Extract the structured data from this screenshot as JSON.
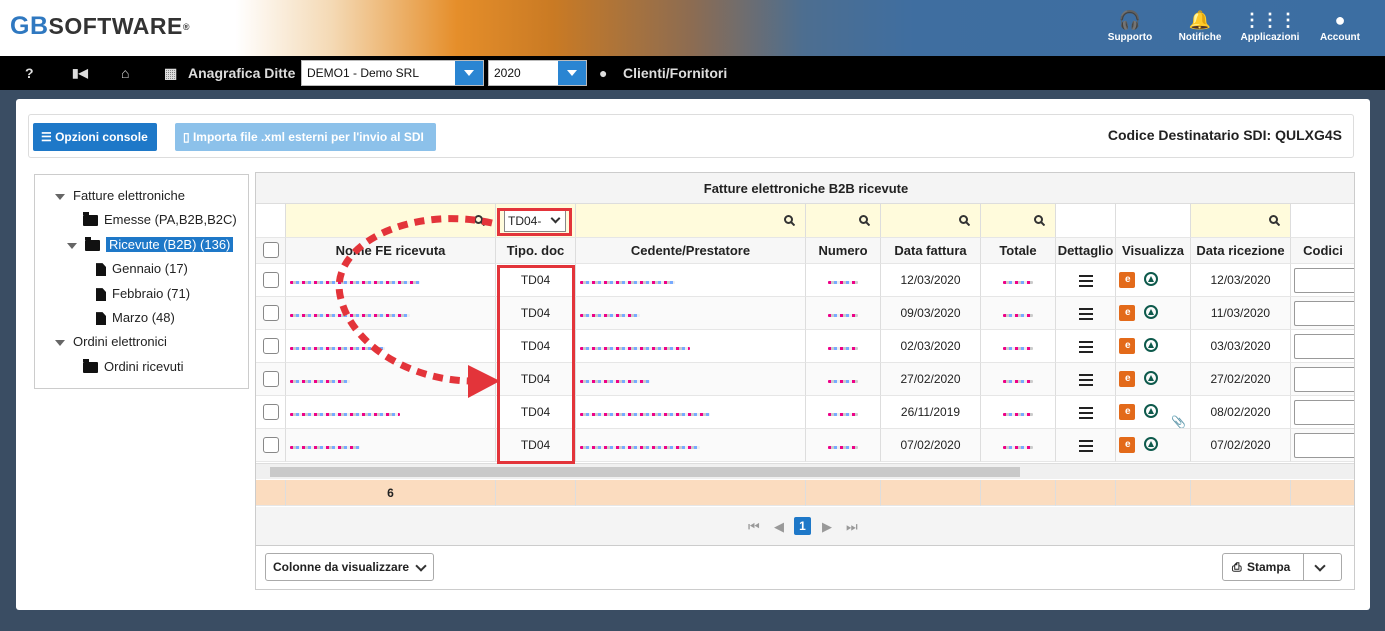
{
  "header": {
    "logo_prefix": "GB",
    "logo_suffix": "SOFTWARE",
    "reg": "®",
    "icons": [
      {
        "label": "Supporto",
        "icon": "headset-icon"
      },
      {
        "label": "Notifiche",
        "icon": "bell-icon"
      },
      {
        "label": "Applicazioni",
        "icon": "grid-icon"
      },
      {
        "label": "Account",
        "icon": "user-icon"
      }
    ]
  },
  "toolbar": {
    "help": "?",
    "anagrafica": "Anagrafica Ditte",
    "company": "DEMO1 - Demo SRL",
    "year": "2020",
    "clienti": "Clienti/Fornitori"
  },
  "actions": {
    "opzioni": "Opzioni console",
    "importa": "Importa file .xml esterni per l'invio al SDI",
    "codice": "Codice Destinatario SDI: QULXG4S"
  },
  "tree": {
    "fatture": "Fatture elettroniche",
    "emesse": "Emesse (PA,B2B,B2C)",
    "ricevute": "Ricevute (B2B) (136)",
    "gennaio": "Gennaio (17)",
    "febbraio": "Febbraio (71)",
    "marzo": "Marzo (48)",
    "ordini": "Ordini elettronici",
    "ordini_ricevuti": "Ordini ricevuti"
  },
  "grid": {
    "title": "Fatture elettroniche B2B ricevute",
    "filter_tipo": "TD04-",
    "columns": [
      "Nome FE ricevuta",
      "Tipo. doc",
      "Cedente/Prestatore",
      "Numero",
      "Data fattura",
      "Totale",
      "Dettaglio",
      "Visualizza",
      "Data ricezione",
      "Codici"
    ],
    "rows": [
      {
        "tipo": "TD04",
        "data": "12/03/2020",
        "ricezione": "12/03/2020",
        "attach": false
      },
      {
        "tipo": "TD04",
        "data": "09/03/2020",
        "ricezione": "11/03/2020",
        "attach": false
      },
      {
        "tipo": "TD04",
        "data": "02/03/2020",
        "ricezione": "03/03/2020",
        "attach": false
      },
      {
        "tipo": "TD04",
        "data": "27/02/2020",
        "ricezione": "27/02/2020",
        "attach": false
      },
      {
        "tipo": "TD04",
        "data": "26/11/2019",
        "ricezione": "08/02/2020",
        "attach": true
      },
      {
        "tipo": "TD04",
        "data": "07/02/2020",
        "ricezione": "07/02/2020",
        "attach": false
      }
    ],
    "footer_count": "6",
    "page": "1"
  },
  "bottom": {
    "colonne": "Colonne da visualizzare",
    "stampa": "Stampa"
  },
  "colors": {
    "accent": "#1e78c8",
    "filter_bg": "#fffbdc",
    "footer_bg": "#fbdcbf",
    "highlight": "#e3343a"
  }
}
